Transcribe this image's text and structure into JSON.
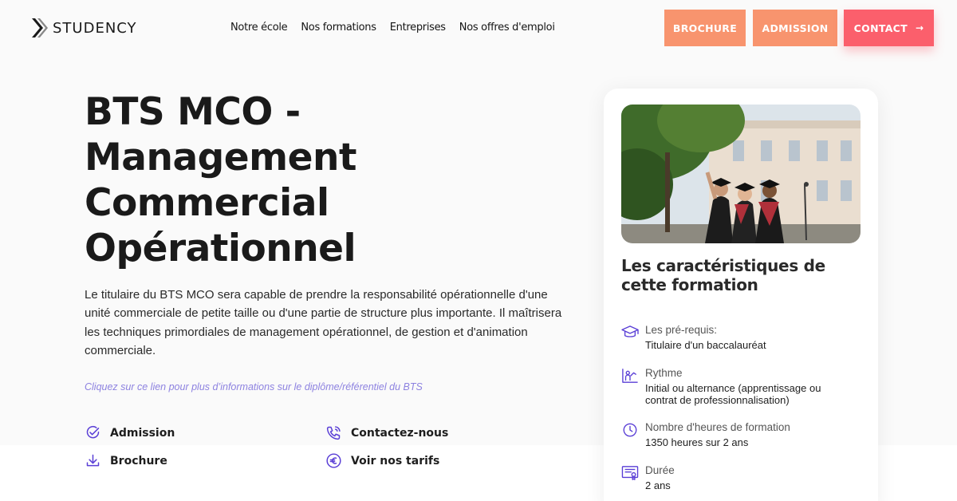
{
  "header": {
    "logo_text": "STUDENCY",
    "nav": [
      "Notre école",
      "Nos formations",
      "Entreprises",
      "Nos offres d'emploi"
    ],
    "buttons": {
      "brochure": "BROCHURE",
      "admission": "ADMISSION",
      "contact": "CONTACT",
      "contact_arrow": "→"
    }
  },
  "hero": {
    "title_lines": [
      "BTS MCO -",
      "Management",
      "Commercial",
      "Opérationnel"
    ],
    "description": "Le titulaire du BTS MCO sera capable de prendre la responsabilité opérationnelle d'une unité commerciale de petite taille ou d'une partie de structure plus importante. Il maîtrisera les techniques primordiales de management opérationnel, de gestion et d'animation commerciale.",
    "info_link": "Cliquez sur ce lien pour plus d’informations sur le diplôme/référentiel du BTS",
    "actions": {
      "admission": "Admission",
      "brochure": "Brochure",
      "contact": "Contactez-nous",
      "tarifs": "Voir nos tarifs"
    }
  },
  "card": {
    "title": "Les caractéristiques de cette formation",
    "features": [
      {
        "icon": "graduation-cap-icon",
        "label": "Les pré-requis:",
        "value": "Titulaire d'un baccalauréat"
      },
      {
        "icon": "person-chart-icon",
        "label": "Rythme",
        "value": "Initial ou alternance (apprentissage ou contrat de professionnalisation)"
      },
      {
        "icon": "clock-icon",
        "label": "Nombre d'heures de formation",
        "value": "1350 heures sur 2 ans"
      },
      {
        "icon": "certificate-icon",
        "label": "Durée",
        "value": "2 ans"
      }
    ]
  },
  "colors": {
    "accent_orange": "#f8946e",
    "accent_red": "#fb5f6c",
    "icon_purple": "#5a3fd6",
    "link_purple": "#8d82e0"
  }
}
